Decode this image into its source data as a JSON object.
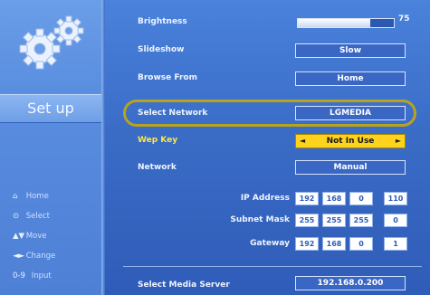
{
  "sidebar": {
    "section_label": "Set up",
    "legend": [
      {
        "icon": "home-icon",
        "glyph": "⌂",
        "label": "Home"
      },
      {
        "icon": "select-icon",
        "glyph": "⊙",
        "label": "Select"
      },
      {
        "icon": "move-icon",
        "glyph": "▲▼",
        "label": "Move"
      },
      {
        "icon": "change-icon",
        "glyph": "◄►",
        "label": "Change"
      },
      {
        "icon": "input-icon",
        "glyph": "0-9",
        "label": "Input"
      }
    ]
  },
  "settings": {
    "brightness": {
      "label": "Brightness",
      "value": "75",
      "level": 0.75
    },
    "slideshow": {
      "label": "Slideshow",
      "value": "Slow"
    },
    "browse_from": {
      "label": "Browse From",
      "value": "Home"
    },
    "select_network": {
      "label": "Select Network",
      "value": "LGMEDIA"
    },
    "wep_key": {
      "label": "Wep Key",
      "value": "Not In Use"
    },
    "network": {
      "label": "Network",
      "value": "Manual"
    },
    "ip_address": {
      "label": "IP Address",
      "octets": [
        "192",
        "168",
        "0",
        "110"
      ]
    },
    "subnet_mask": {
      "label": "Subnet Mask",
      "octets": [
        "255",
        "255",
        "255",
        "0"
      ]
    },
    "gateway": {
      "label": "Gateway",
      "octets": [
        "192",
        "168",
        "0",
        "1"
      ]
    },
    "media_server": {
      "label": "Select Media Server",
      "value": "192.168.0.200"
    }
  },
  "colors": {
    "highlight": "#b9a31d",
    "wep_box": "#ffd21c",
    "label_yellow": "#ffe64a"
  }
}
